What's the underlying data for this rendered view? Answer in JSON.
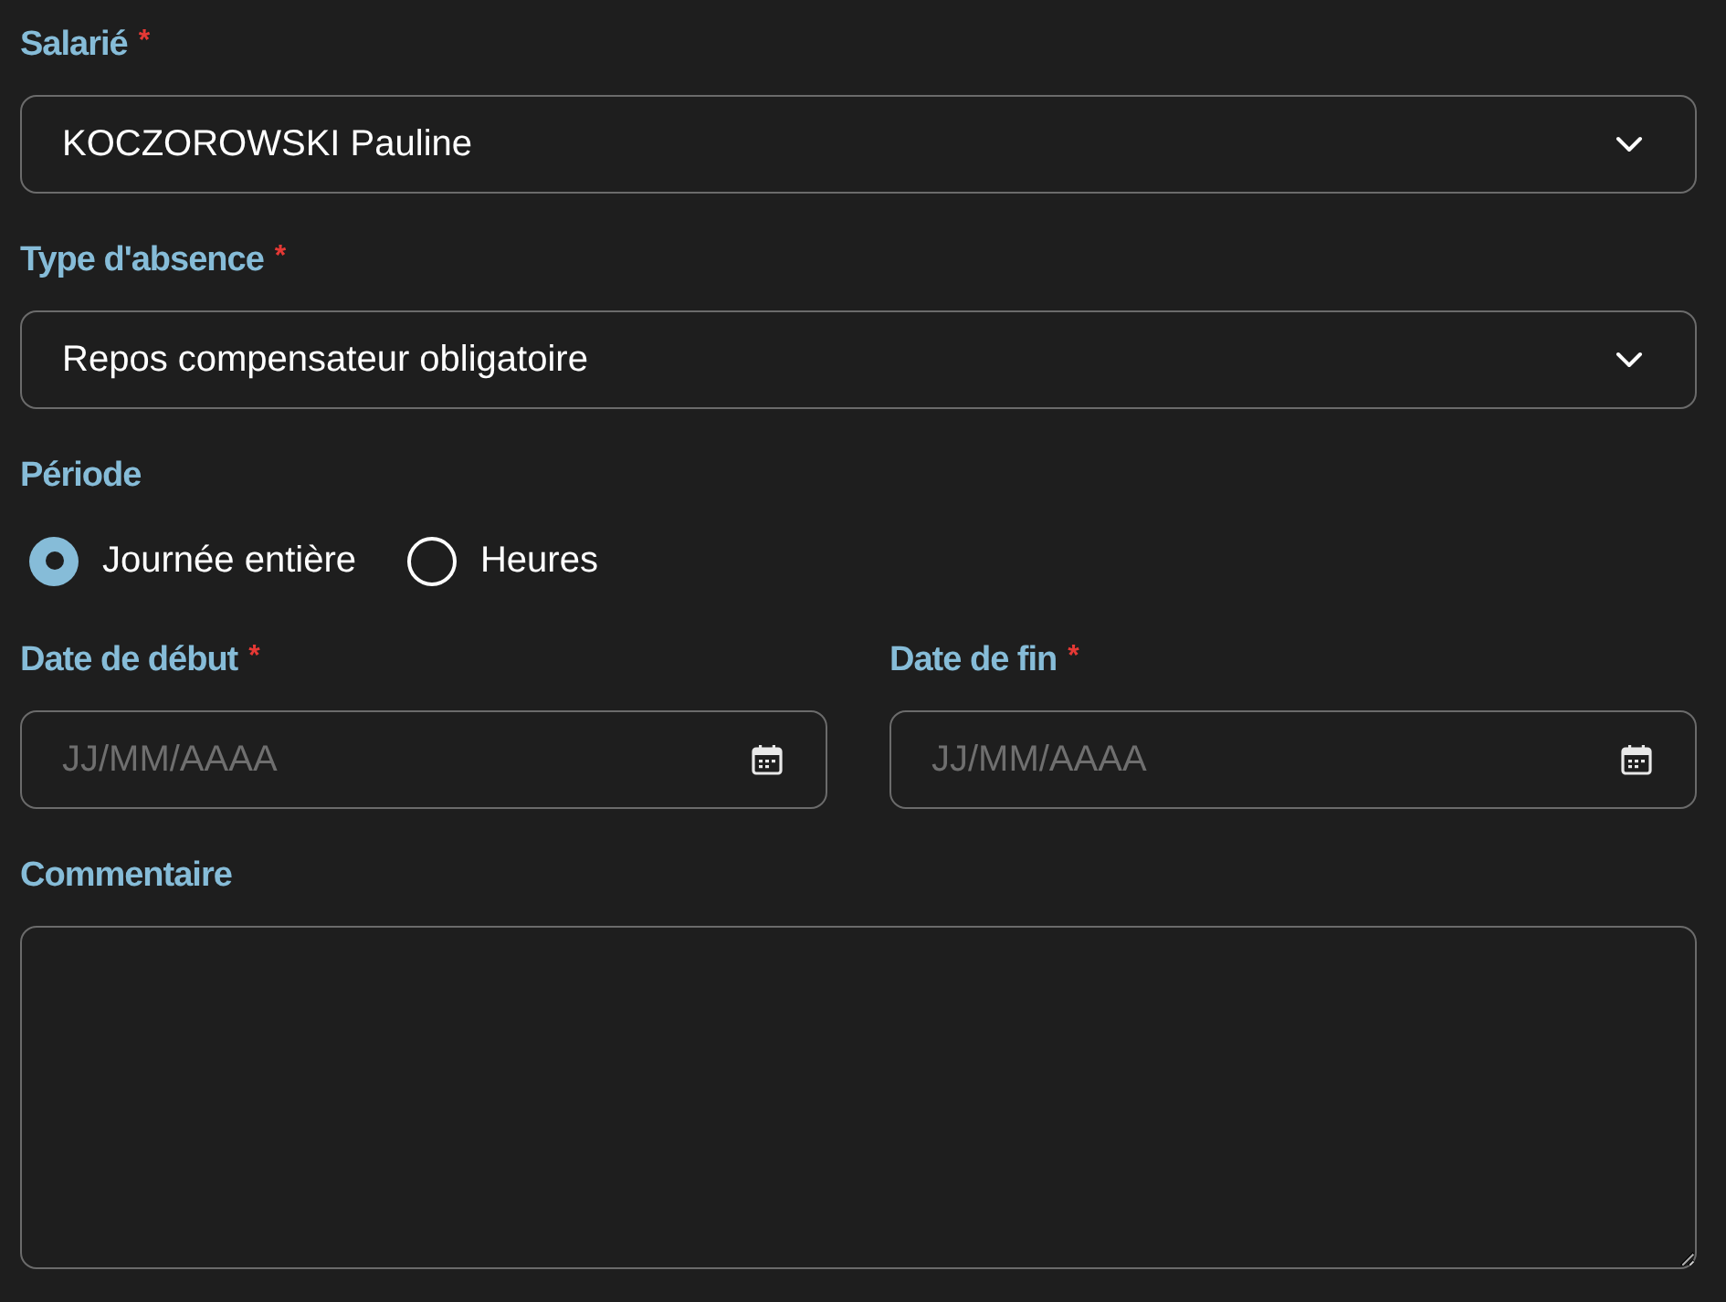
{
  "fields": [
    {
      "kind": "select",
      "label": "Salarié",
      "required_mark": "*",
      "value": "KOCZOROWSKI Pauline"
    },
    {
      "kind": "select",
      "label": "Type d'absence",
      "required_mark": "*",
      "value": "Repos compensateur obligatoire"
    },
    {
      "kind": "radio",
      "label": "Période",
      "options": [
        {
          "label": "Journée entière",
          "selected": true
        },
        {
          "label": "Heures",
          "selected": false
        }
      ]
    },
    {
      "kind": "dates",
      "items": [
        {
          "label": "Date de début",
          "required_mark": "*",
          "placeholder": "JJ/MM/AAAA"
        },
        {
          "label": "Date de fin",
          "required_mark": "*",
          "placeholder": "JJ/MM/AAAA"
        }
      ]
    },
    {
      "kind": "textarea",
      "label": "Commentaire"
    }
  ]
}
